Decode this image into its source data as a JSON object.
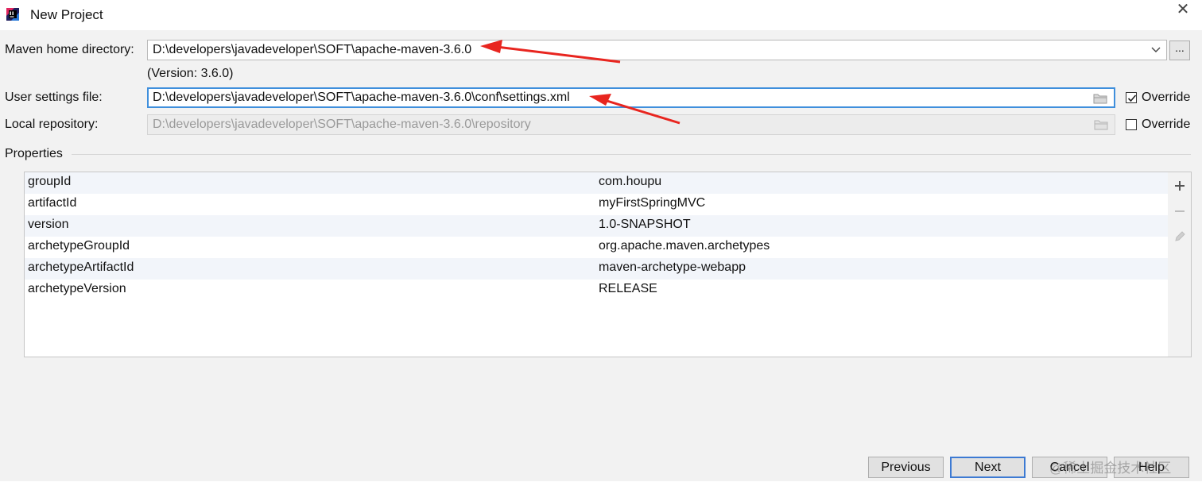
{
  "window": {
    "title": "New Project"
  },
  "maven_home": {
    "label": "Maven home directory:",
    "value": "D:\\developers\\javadeveloper\\SOFT\\apache-maven-3.6.0",
    "browse_label": "...",
    "version_note": "(Version: 3.6.0)"
  },
  "user_settings": {
    "label": "User settings file:",
    "value": "D:\\developers\\javadeveloper\\SOFT\\apache-maven-3.6.0\\conf\\settings.xml",
    "override_label": "Override",
    "override_checked": true
  },
  "local_repo": {
    "label": "Local repository:",
    "value": "D:\\developers\\javadeveloper\\SOFT\\apache-maven-3.6.0\\repository",
    "override_label": "Override",
    "override_checked": false
  },
  "properties": {
    "title": "Properties",
    "rows": [
      {
        "key": "groupId",
        "value": "com.houpu"
      },
      {
        "key": "artifactId",
        "value": "myFirstSpringMVC"
      },
      {
        "key": "version",
        "value": "1.0-SNAPSHOT"
      },
      {
        "key": "archetypeGroupId",
        "value": "org.apache.maven.archetypes"
      },
      {
        "key": "archetypeArtifactId",
        "value": "maven-archetype-webapp"
      },
      {
        "key": "archetypeVersion",
        "value": "RELEASE"
      }
    ]
  },
  "buttons": {
    "previous": "Previous",
    "next": "Next",
    "cancel": "Cancel",
    "help": "Help"
  },
  "watermark": "@稀土掘金技术社区",
  "colors": {
    "accent": "#3d7ad3",
    "annotation_arrow": "#e8251f"
  }
}
